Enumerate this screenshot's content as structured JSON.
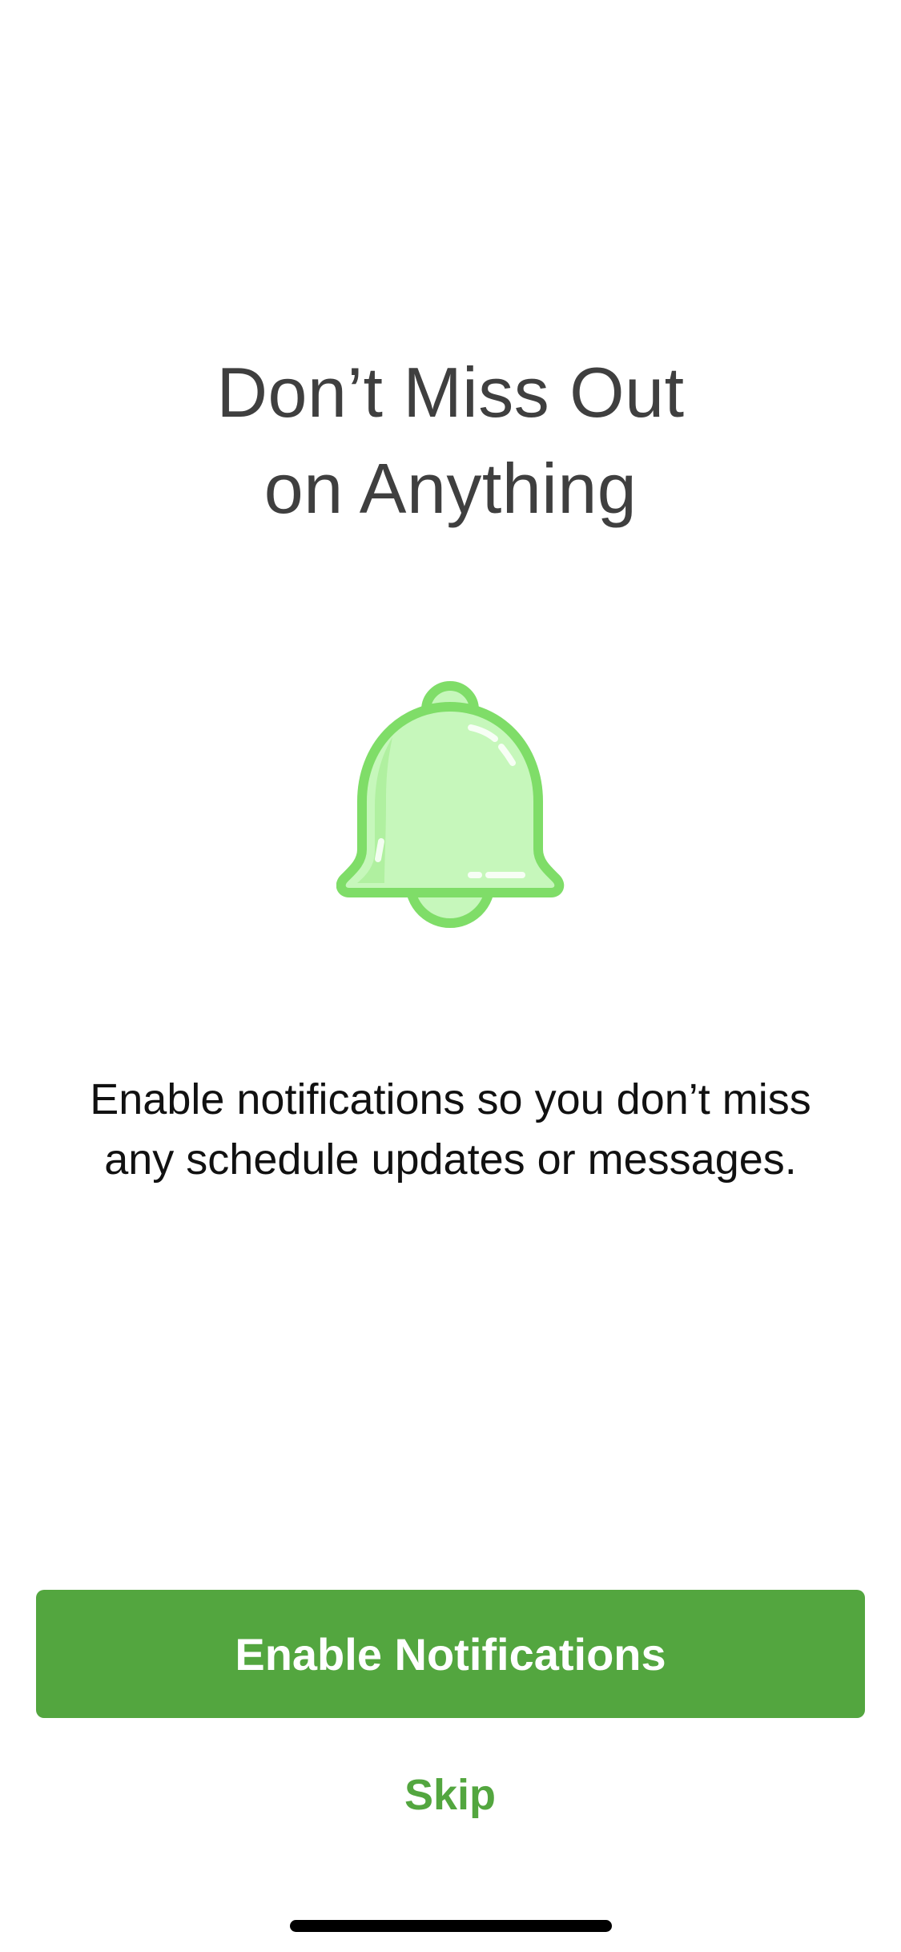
{
  "onboarding": {
    "title_line1": "Don’t Miss Out",
    "title_line2": "on Anything",
    "icon": "bell-icon",
    "message": "Enable notifications so you don’t miss any schedule updates or messages.",
    "primary_button_label": "Enable Notifications",
    "skip_label": "Skip"
  },
  "colors": {
    "accent": "#53a63f",
    "bell_fill": "#c6f7bb",
    "bell_outline": "#7fdd68",
    "title_text": "#3f3f3f",
    "body_text": "#111111",
    "background": "#ffffff"
  }
}
